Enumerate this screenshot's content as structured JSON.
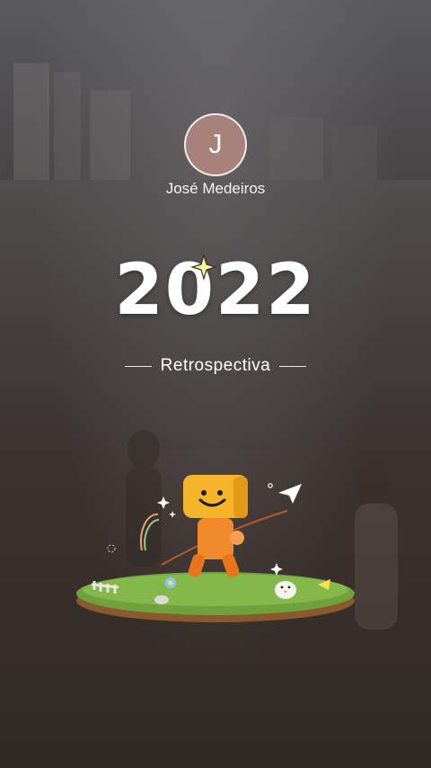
{
  "profile": {
    "initial": "J",
    "name": "José Medeiros"
  },
  "hero": {
    "year": "2022",
    "subtitle": "Retrospectiva"
  },
  "illustration": {
    "icon": "mascot-on-grass-island-icon"
  },
  "colors": {
    "avatar_bg": "#a6827a",
    "mascot_head": "#f5b52a",
    "mascot_body": "#f08a2a",
    "grass": "#6fa23c"
  }
}
